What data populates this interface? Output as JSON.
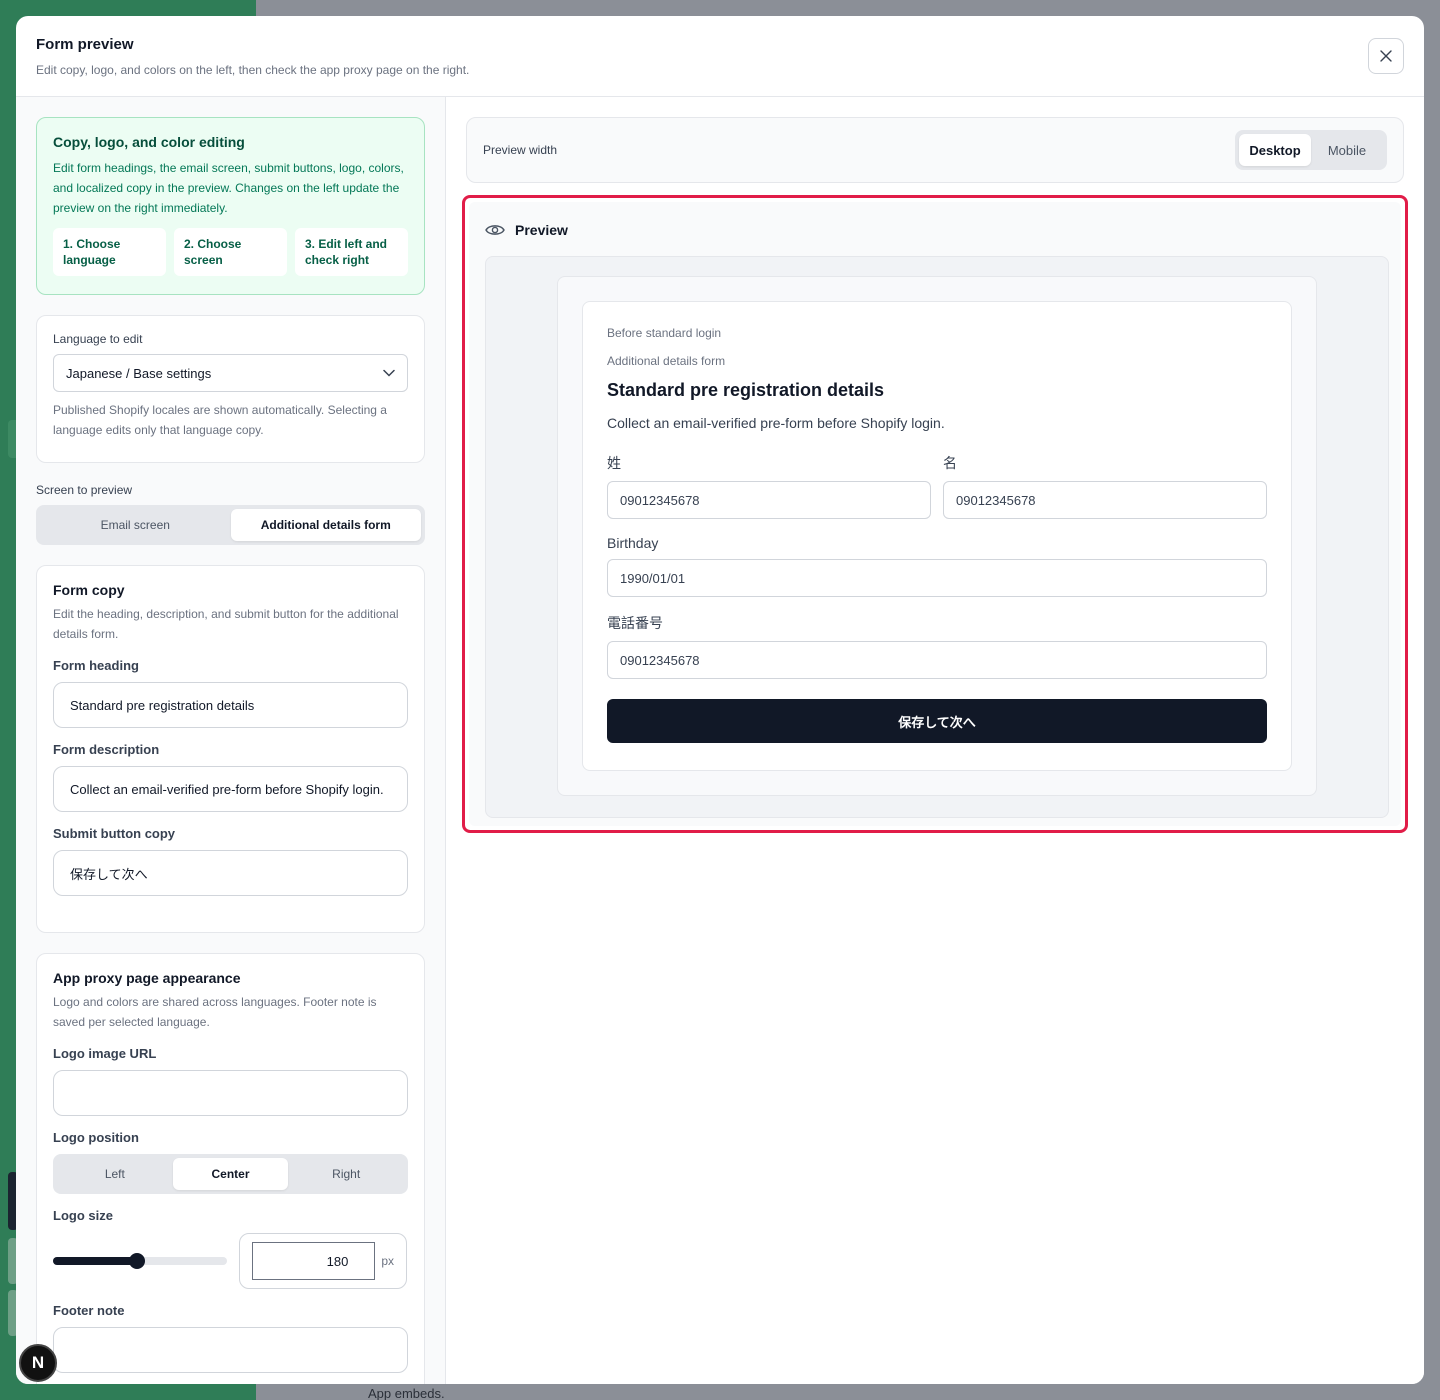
{
  "background": {
    "bottom_text": "App embeds."
  },
  "modal": {
    "title": "Form preview",
    "subtitle": "Edit copy, logo, and colors on the left, then check the app proxy page on the right."
  },
  "info": {
    "title": "Copy, logo, and color editing",
    "text": "Edit form headings, the email screen, submit buttons, logo, colors, and localized copy in the preview. Changes on the left update the preview on the right immediately.",
    "steps": [
      "1. Choose language",
      "2. Choose screen",
      "3. Edit left and check right"
    ]
  },
  "language": {
    "label": "Language to edit",
    "value": "Japanese / Base settings",
    "help": "Published Shopify locales are shown automatically. Selecting a language edits only that language copy."
  },
  "screen": {
    "label": "Screen to preview",
    "options": [
      "Email screen",
      "Additional details form"
    ],
    "selected": "Additional details form"
  },
  "form_copy": {
    "title": "Form copy",
    "desc": "Edit the heading, description, and submit button for the additional details form.",
    "heading_label": "Form heading",
    "heading_value": "Standard pre registration details",
    "description_label": "Form description",
    "description_value": "Collect an email-verified pre-form before Shopify login.",
    "submit_label": "Submit button copy",
    "submit_value": "保存して次へ"
  },
  "appearance": {
    "title": "App proxy page appearance",
    "desc": "Logo and colors are shared across languages. Footer note is saved per selected language.",
    "logo_url_label": "Logo image URL",
    "logo_url_value": "",
    "logo_position_label": "Logo position",
    "positions": [
      "Left",
      "Center",
      "Right"
    ],
    "selected_position": "Center",
    "logo_size_label": "Logo size",
    "logo_size_value": "180",
    "logo_size_fraction": 0.48,
    "logo_size_unit": "px",
    "footer_note_label": "Footer note"
  },
  "preview_width": {
    "label": "Preview width",
    "options": [
      "Desktop",
      "Mobile"
    ],
    "selected": "Desktop"
  },
  "preview": {
    "title": "Preview",
    "eyebrow1": "Before standard login",
    "eyebrow2": "Additional details form",
    "heading": "Standard pre registration details",
    "description": "Collect an email-verified pre-form before Shopify login.",
    "last_name_label": "姓",
    "last_name_value": "09012345678",
    "first_name_label": "名",
    "first_name_value": "09012345678",
    "birthday_label": "Birthday",
    "birthday_value": "1990/01/01",
    "phone_label": "電話番号",
    "phone_value": "09012345678",
    "button": "保存して次へ"
  },
  "badge": {
    "letter": "N"
  },
  "colors": {
    "accent_green": "#2f7d57",
    "highlight_red": "#e11d48",
    "button_dark": "#111827"
  }
}
